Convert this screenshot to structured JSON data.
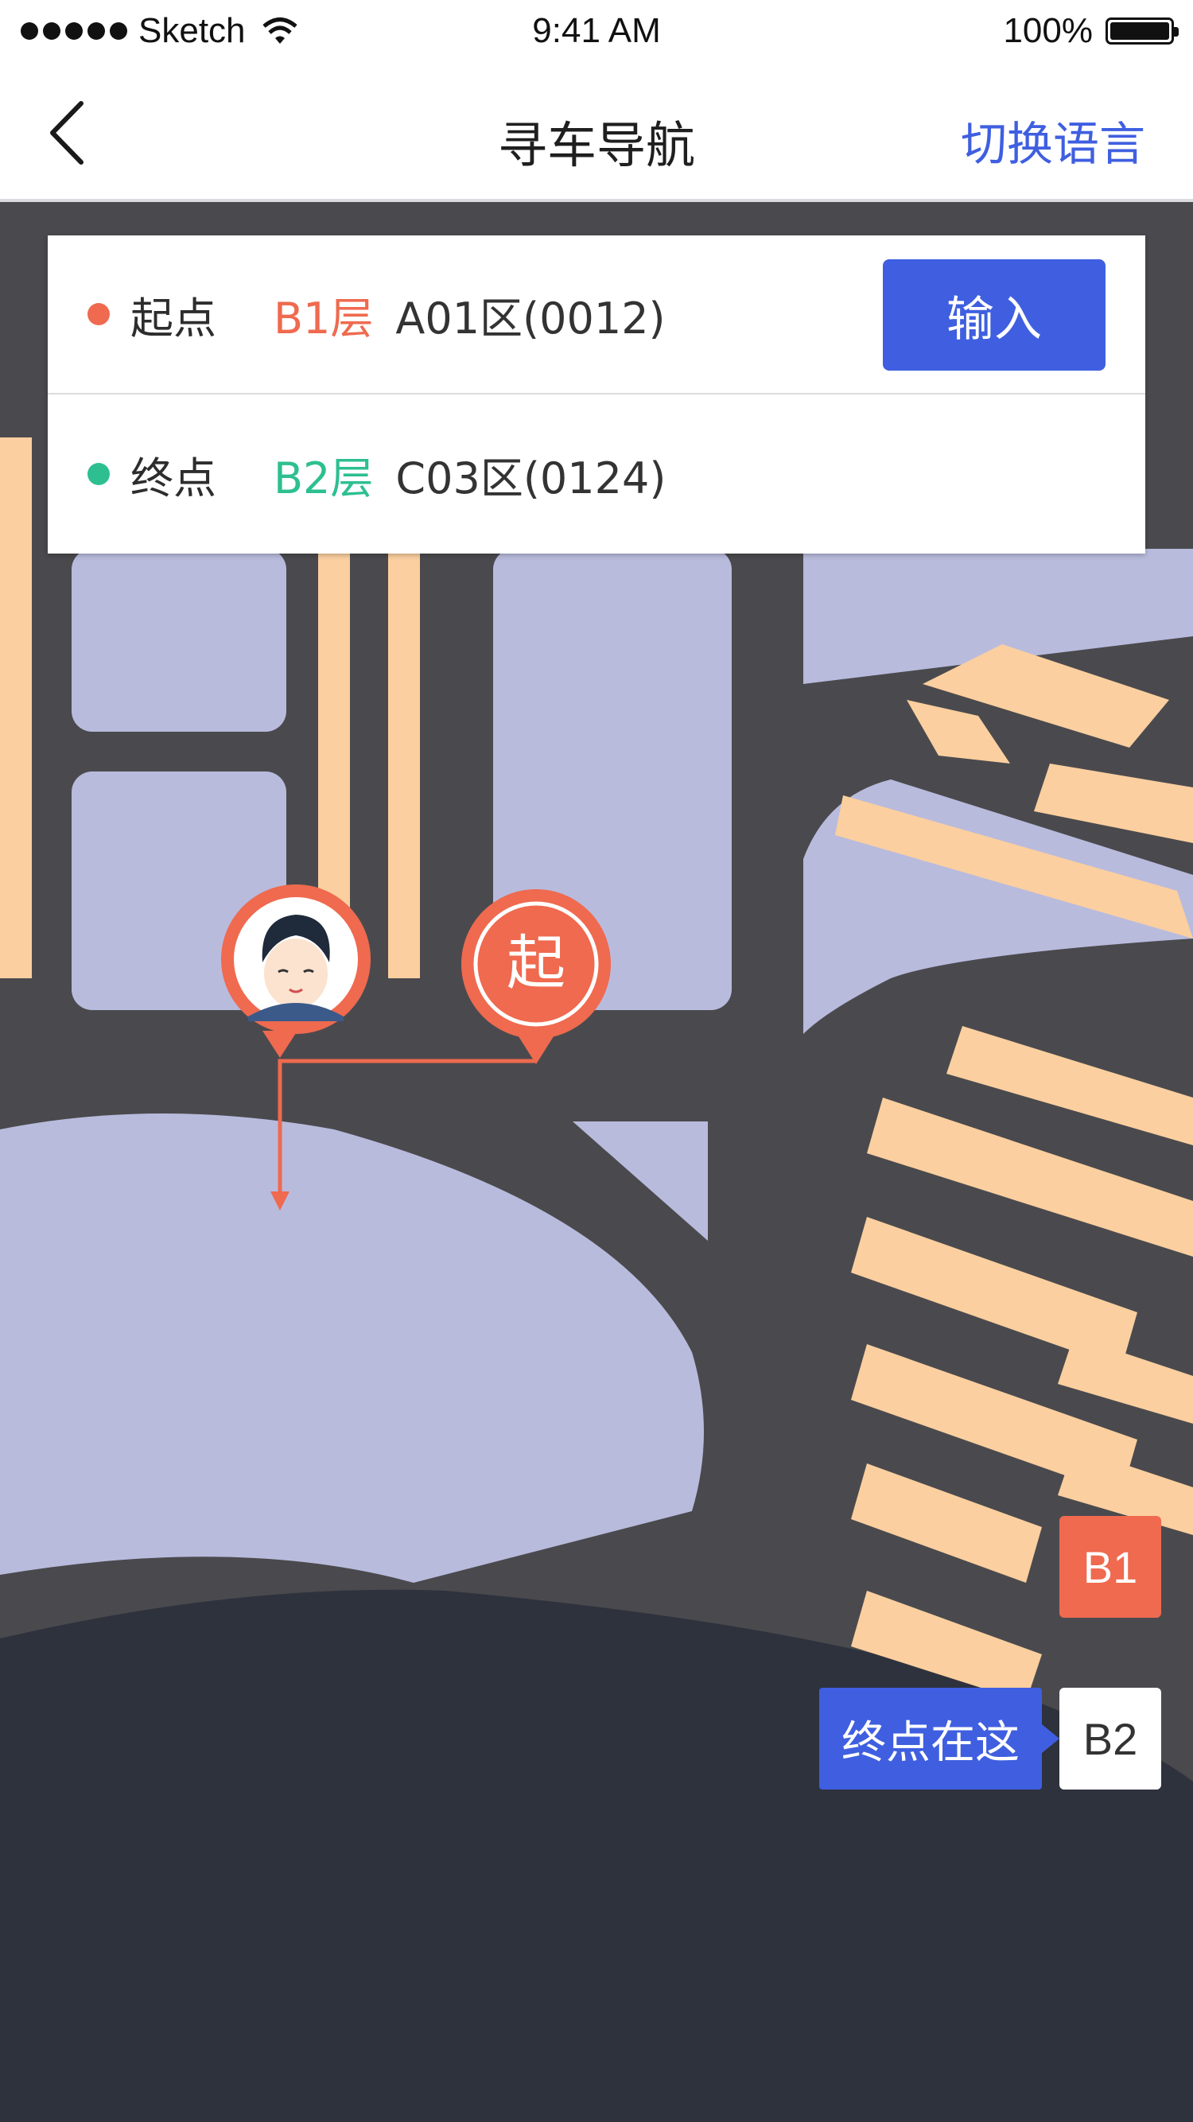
{
  "status_bar": {
    "carrier": "Sketch",
    "time": "9:41 AM",
    "battery": "100%"
  },
  "nav": {
    "title": "寻车导航",
    "action": "切换语言"
  },
  "route": {
    "start": {
      "label": "起点",
      "floor": "B1层",
      "zone": "A01区(0012)",
      "color": "#ef6a4f"
    },
    "end": {
      "label": "终点",
      "floor": "B2层",
      "zone": "C03区(0124)",
      "color": "#2ebf91"
    },
    "input_button": "输入"
  },
  "map": {
    "start_marker": "起",
    "floor_b1": "B1",
    "floor_b2": "B2",
    "destination_tip": "终点在这",
    "colors": {
      "road": "#4a4a4e",
      "area": "#b9bbdd",
      "parking": "#fbcf9f",
      "dark": "#2e323d",
      "route": "#ef6a4f"
    }
  }
}
